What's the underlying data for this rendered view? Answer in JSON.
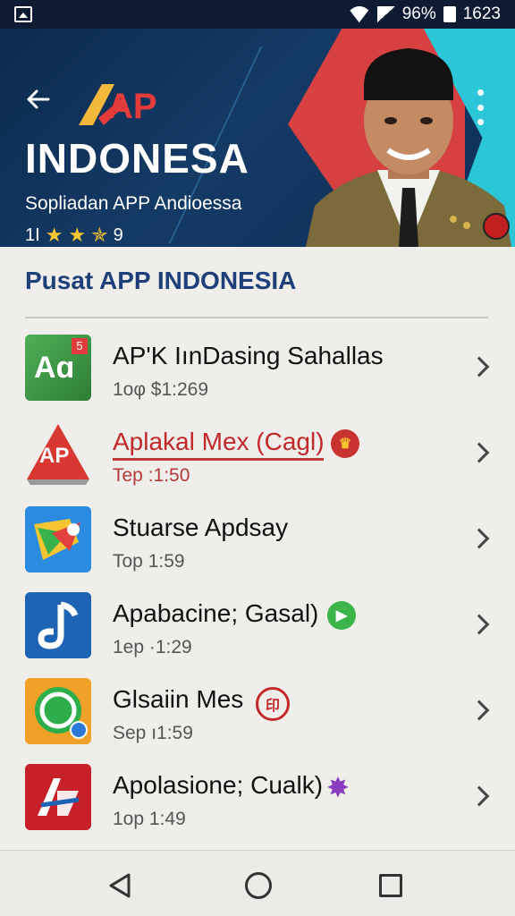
{
  "status_bar": {
    "battery": "96%",
    "time": "1623"
  },
  "header": {
    "logo_text": "AP",
    "title": "INDONESA",
    "subtitle": "Sopliadan APP Andioessa",
    "rating_prefix": "1I",
    "rating_count": "9",
    "stars": 3.5
  },
  "section": {
    "title": "Pusat APP INDONESIA"
  },
  "apps": [
    {
      "name": "AP'K IınDasing Sahallas",
      "meta": "1oφ $1:269",
      "icon_text": "Aɑ",
      "icon_badge": "5",
      "icon_color": "#3f9a47"
    },
    {
      "name": "Aplakal Mex (Cagl)",
      "meta": "Tep :1:50",
      "icon_text": "AP",
      "icon_color": "#d93832"
    },
    {
      "name": "Stuarse Apdsay",
      "meta": "Top 1:59",
      "icon_color": "#1f78c8"
    },
    {
      "name": "Apabacine; Gasal)",
      "meta": "1ep ·1:29",
      "icon_color": "#1f63b4"
    },
    {
      "name": "Glsaiin Mes",
      "meta": "Sep ı1:59",
      "icon_color": "#f0a127"
    },
    {
      "name": "Apolasione; Cualk)",
      "meta": "1op 1:49",
      "icon_color": "#c8202a"
    }
  ],
  "colors": {
    "header_bg": "#143a66",
    "accent_red": "#e3413f",
    "accent_cyan": "#2bc6d8",
    "section_title": "#1e3f7a"
  }
}
